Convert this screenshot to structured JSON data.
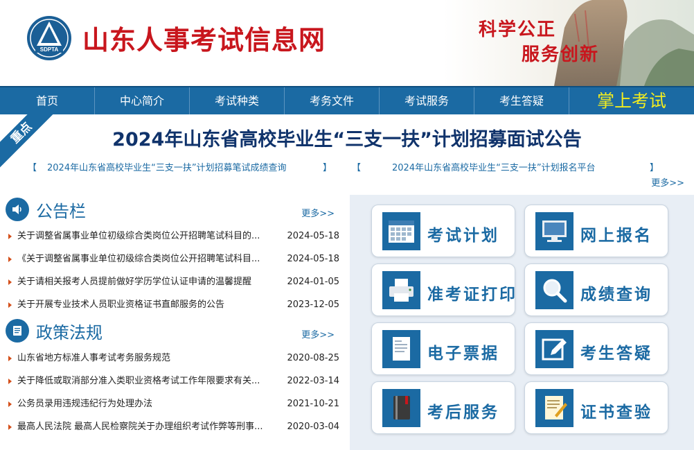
{
  "header": {
    "logo_text": "SDPTA",
    "site_title": "山东人事考试信息网",
    "slogan_line1": "科学公正",
    "slogan_line2": "服务创新"
  },
  "nav": {
    "items": [
      "首页",
      "中心简介",
      "考试种类",
      "考务文件",
      "考试服务",
      "考生答疑"
    ],
    "mobile": "掌上考试"
  },
  "headline": {
    "ribbon": "重点",
    "title": "2024年山东省高校毕业生“三支一扶”计划招募面试公告",
    "sub_links": [
      "2024年山东省高校毕业生“三支一扶”计划招募笔试成绩查询",
      "2024年山东省高校毕业生“三支一扶”计划报名平台"
    ],
    "bracket_open": "【",
    "bracket_close": "】",
    "more": "更多>>"
  },
  "announcements": {
    "title": "公告栏",
    "more": "更多>>",
    "items": [
      {
        "title": "关于调整省属事业单位初级综合类岗位公开招聘笔试科目的...",
        "date": "2024-05-18"
      },
      {
        "title": "《关于调整省属事业单位初级综合类岗位公开招聘笔试科目...",
        "date": "2024-05-18"
      },
      {
        "title": "关于请相关报考人员提前做好学历学位认证申请的温馨提醒",
        "date": "2024-01-05"
      },
      {
        "title": "关于开展专业技术人员职业资格证书直邮服务的公告",
        "date": "2023-12-05"
      }
    ]
  },
  "policies": {
    "title": "政策法规",
    "more": "更多>>",
    "items": [
      {
        "title": "山东省地方标准人事考试考务服务规范",
        "date": "2020-08-25"
      },
      {
        "title": "关于降低或取消部分准入类职业资格考试工作年限要求有关...",
        "date": "2022-03-14"
      },
      {
        "title": "公务员录用违规违纪行为处理办法",
        "date": "2021-10-21"
      },
      {
        "title": "最高人民法院 最高人民检察院关于办理组织考试作弊等刑事...",
        "date": "2020-03-04"
      }
    ]
  },
  "services": [
    {
      "label": "考试计划",
      "icon": "calendar-icon"
    },
    {
      "label": "网上报名",
      "icon": "monitor-icon"
    },
    {
      "label": "准考证打印",
      "icon": "printer-icon"
    },
    {
      "label": "成绩查询",
      "icon": "magnifier-icon"
    },
    {
      "label": "电子票据",
      "icon": "document-icon"
    },
    {
      "label": "考生答疑",
      "icon": "pen-edit-icon"
    },
    {
      "label": "考后服务",
      "icon": "book-icon"
    },
    {
      "label": "证书查验",
      "icon": "certificate-icon"
    }
  ],
  "colors": {
    "brand_blue": "#1b6aa3",
    "title_red": "#c8161d",
    "mobile_yellow": "#f2ec1f",
    "headline_navy": "#10336b"
  }
}
